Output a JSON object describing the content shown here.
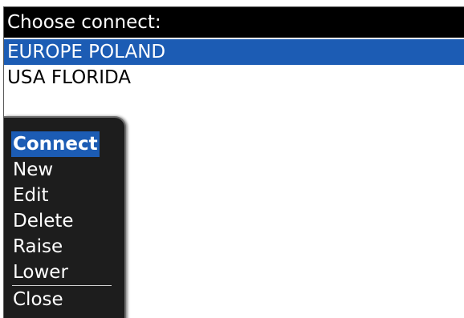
{
  "title": "Choose connect:",
  "connections": [
    {
      "label": "EUROPE POLAND",
      "selected": true
    },
    {
      "label": "USA FLORIDA",
      "selected": false
    }
  ],
  "menu": {
    "items": [
      "Connect",
      "New",
      "Edit",
      "Delete",
      "Raise",
      "Lower"
    ],
    "close_label": "Close"
  },
  "colors": {
    "title_bg": "#000000",
    "selection": "#1c5cb4",
    "menu_bg": "#1d1d1d"
  }
}
